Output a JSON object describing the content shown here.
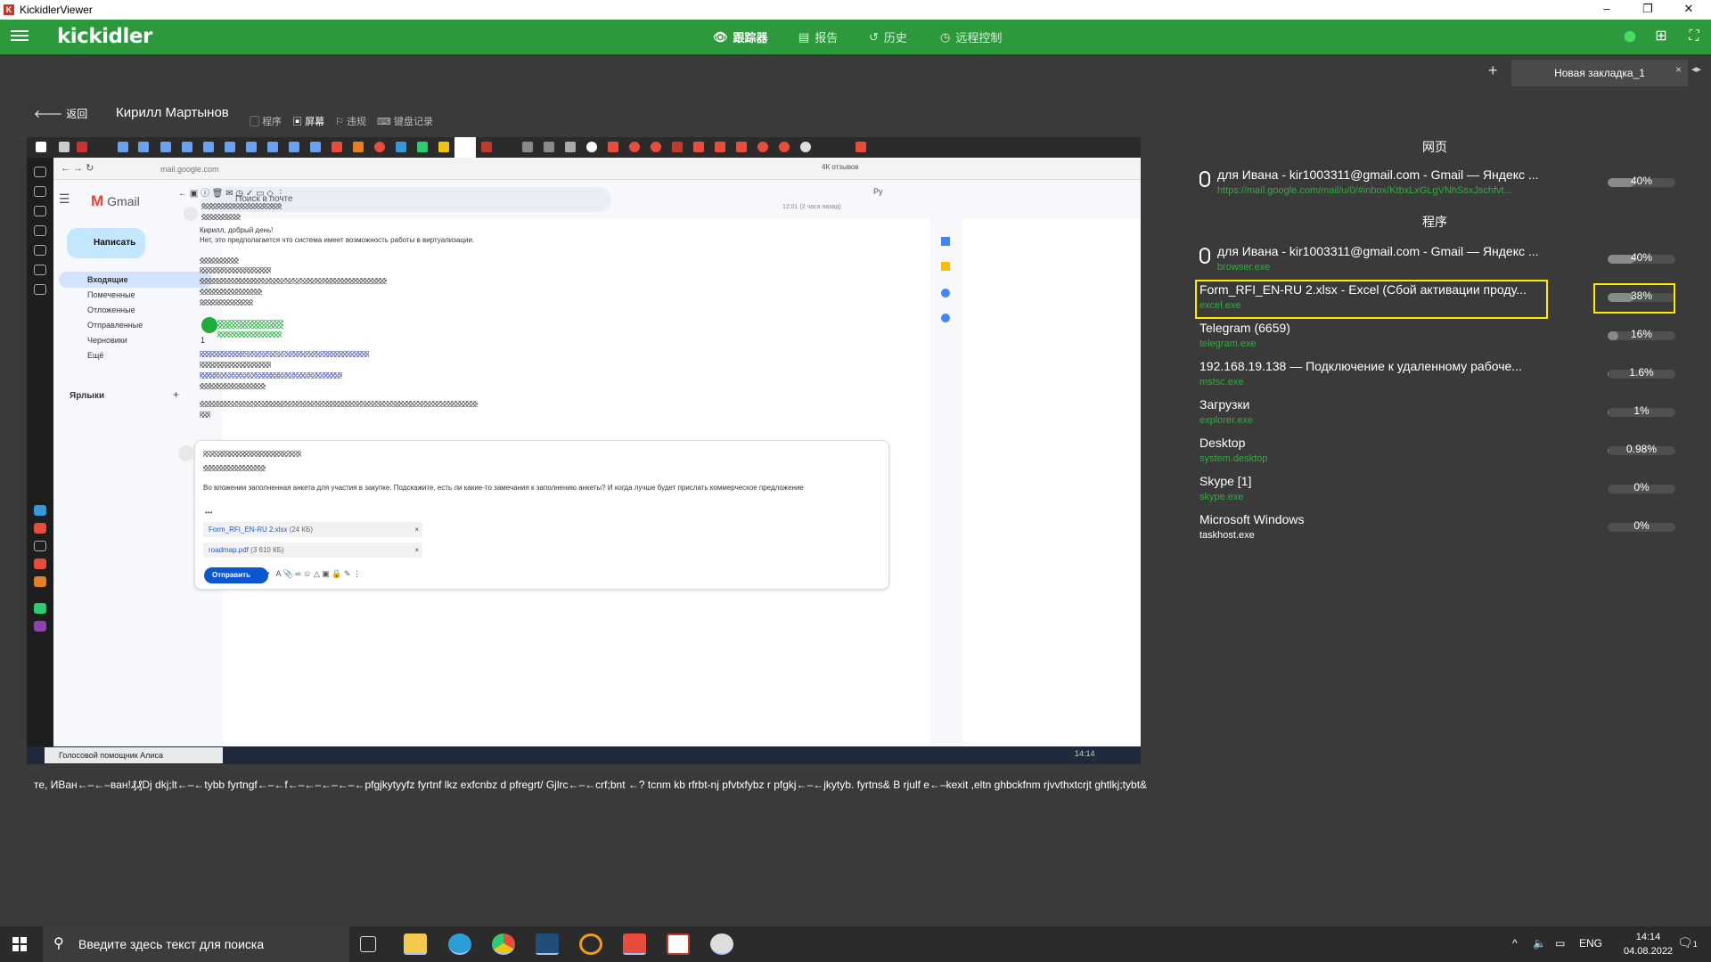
{
  "window": {
    "title": "KickidlerViewer",
    "minimize": "–",
    "restore": "❐",
    "close": "✕"
  },
  "appbar": {
    "logo": "kickidler",
    "nav": [
      {
        "icon": "👁",
        "label": "跟踪器",
        "active": true
      },
      {
        "icon": "▤",
        "label": "报告",
        "active": false
      },
      {
        "icon": "↺",
        "label": "历史",
        "active": false
      },
      {
        "icon": "◷",
        "label": "远程控制",
        "active": false
      }
    ],
    "status_color": "#4ddc5c"
  },
  "tabs": {
    "add": "+",
    "items": [
      {
        "label": "Новая закладка_1"
      }
    ],
    "close": "×",
    "scroll": "◂▸"
  },
  "header": {
    "back_label": "返回",
    "user_name": "Кирилл Мартынов",
    "modes": [
      {
        "label": "程序",
        "active": false
      },
      {
        "label": "屏幕",
        "active": true
      },
      {
        "label": "违规",
        "active": false
      },
      {
        "label": "键盘记录",
        "active": false
      }
    ]
  },
  "screen": {
    "url": "mail.google.com",
    "reviews": "4К отзывов",
    "gmail": {
      "brand": "Gmail",
      "search_placeholder": "Поиск в почте",
      "compose": "Написать",
      "folders": [
        {
          "label": "Входящие",
          "selected": true,
          "count": ""
        },
        {
          "label": "Помеченные",
          "selected": false,
          "count": ""
        },
        {
          "label": "Отложенные",
          "selected": false,
          "count": ""
        },
        {
          "label": "Отправленные",
          "selected": false,
          "count": ""
        },
        {
          "label": "Черновики",
          "selected": false,
          "count": "1"
        },
        {
          "label": "Ещё",
          "selected": false,
          "count": ""
        }
      ],
      "labels_header": "Ярлыки",
      "labels_add": "+",
      "time": "12:01 (2 часа назад)",
      "lang": "Ру",
      "greeting": "Кирилл, добрый день!",
      "body_line": "Нет, это предполагается что система имеет возможность работы в виртуализации.",
      "reply_text": "Во вложении заполненная анкета для участия в закупке. Подскажите, есть ли какие-то замечания к заполнению анкеты? И когда лучше будет прислать коммерческое предложение",
      "ellipsis": "•••",
      "attachments": [
        {
          "name": "Form_RFI_EN-RU 2.xlsx",
          "size": "(24 КБ)"
        },
        {
          "name": "roadmap.pdf",
          "size": "(3 610 КБ)"
        }
      ],
      "send": "Отправить"
    },
    "alice": "Голосовой помощник Алиса",
    "inner_clock": "14:14"
  },
  "caption": "те, ИВан←–←–ван!₰₰Dj dkj;lt←–←tybb fyrtngf←–←f←–←–←–←–←pfgjkytyyfz fyrtnf lkz exfcnbz d pfregrt/ Gjlrc←–←crf;bnt ←? tcnm kb rfrbt-nj pfvtxfybz r pfgkj←–←jkytyb. fyrtns& B rjulf e←–kexit ,eltn ghbckfnm rjvvthxtcrjt ghtlkj;tybt&",
  "panel": {
    "web_header": "网页",
    "web_rows": [
      {
        "title": "для Ивана - kir1003311@gmail.com - Gmail — Яндекс ...",
        "sub": "https://mail.google.com/mail/u/0/#inbox/KtbxLxGLgVNhSsxJschfvt...",
        "percent_text": "40%",
        "percent": 40
      }
    ],
    "app_header": "程序",
    "app_rows": [
      {
        "title": "для Ивана - kir1003311@gmail.com - Gmail — Яндекс ...",
        "sub": "browser.exe",
        "percent_text": "40%",
        "percent": 40,
        "has_icon": true
      },
      {
        "title": "Form_RFI_EN-RU 2.xlsx - Excel (Сбой активации проду...",
        "sub": "excel.exe",
        "percent_text": "38%",
        "percent": 38,
        "highlighted": true
      },
      {
        "title": "Telegram (6659)",
        "sub": "telegram.exe",
        "percent_text": "16%",
        "percent": 16
      },
      {
        "title": "192.168.19.138 — Подключение к удаленному рабоче...",
        "sub": "mstsc.exe",
        "percent_text": "1.6%",
        "percent": 1.6
      },
      {
        "title": "Загрузки",
        "sub": "explorer.exe",
        "percent_text": "1%",
        "percent": 1
      },
      {
        "title": "Desktop",
        "sub": "system.desktop",
        "percent_text": "0.98%",
        "percent": 0.98
      },
      {
        "title": "Skype [1]",
        "sub": "skype.exe",
        "percent_text": "0%",
        "percent": 0
      },
      {
        "title": "Microsoft Windows",
        "sub": "taskhost.exe",
        "percent_text": "0%",
        "percent": 0
      }
    ],
    "highlight_color": "#ffeb00",
    "sub_color": "#2ead3e"
  },
  "taskbar": {
    "search_placeholder": "Введите здесь текст для поиска",
    "lang": "ENG",
    "time": "14:14",
    "date": "04.08.2022",
    "notifications": "1"
  }
}
